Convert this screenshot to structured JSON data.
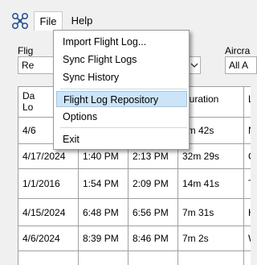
{
  "menubar": {
    "file": "File",
    "help": "Help"
  },
  "filters": {
    "flight_label": "Flig",
    "flight_value": "Re",
    "aircraft_label": "Aircra",
    "aircraft_value": "All A"
  },
  "grid": {
    "headers": [
      {
        "line1": "Da",
        "line2": "Lo"
      },
      {
        "line1": "",
        "line2": ""
      },
      {
        "line1": "",
        "line2": ""
      },
      {
        "line1": "Duration",
        "line2": ""
      },
      {
        "line1": "L",
        "line2": ""
      }
    ],
    "rows": [
      {
        "date": "4/6",
        "start": "",
        "end": "",
        "duration": "2m 42s",
        "loc": "N"
      },
      {
        "date": "4/17/2024",
        "start": "1:40 PM",
        "end": "2:13 PM",
        "duration": "32m 29s",
        "loc": "C"
      },
      {
        "date": "1/1/2016",
        "start": "1:54 PM",
        "end": "2:09 PM",
        "duration": "14m 41s",
        "loc": "T"
      },
      {
        "date": "4/15/2024",
        "start": "6:48 PM",
        "end": "6:56 PM",
        "duration": "7m 31s",
        "loc": "H"
      },
      {
        "date": "4/6/2024",
        "start": "8:39 PM",
        "end": "8:46 PM",
        "duration": "7m 2s",
        "loc": "W"
      },
      {
        "date": "",
        "start": "",
        "end": "",
        "duration": "",
        "loc": ""
      }
    ]
  },
  "file_menu": {
    "items": [
      {
        "label": "Import Flight Log..."
      },
      {
        "label": "Sync Flight Logs"
      },
      {
        "label": "Sync History"
      },
      {
        "label": "Flight Log Repository"
      },
      {
        "label": "Options"
      },
      {
        "label": "Exit"
      }
    ],
    "highlighted": "Flight Log Repository"
  },
  "colors": {
    "highlight_bg": "#cce4f7",
    "highlight_border": "#99c9ef",
    "icon_blue": "#2b5797"
  }
}
